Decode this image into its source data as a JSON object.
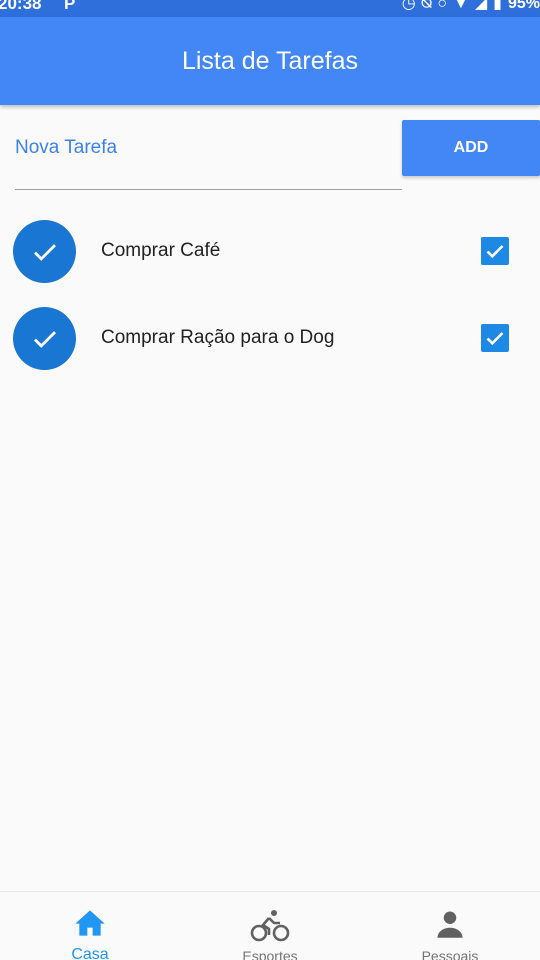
{
  "status_bar": {
    "time": "20:38",
    "app_icon": "P",
    "battery": "95%"
  },
  "appbar": {
    "title": "Lista de Tarefas"
  },
  "new_task": {
    "placeholder": "Nova Tarefa",
    "value": "",
    "add_label": "ADD"
  },
  "tasks": [
    {
      "label": "Comprar Café",
      "done": true
    },
    {
      "label": "Comprar Ração para o Dog",
      "done": true
    }
  ],
  "bottom_nav": [
    {
      "label": "Casa",
      "icon": "home-icon",
      "active": true
    },
    {
      "label": "Esportes",
      "icon": "bike-icon",
      "active": false
    },
    {
      "label": "Pessoais",
      "icon": "person-icon",
      "active": false
    }
  ],
  "colors": {
    "primary": "#4287f5",
    "status_bar": "#2f6fdc",
    "avatar": "#1976d2",
    "active_nav": "#2196f3"
  }
}
